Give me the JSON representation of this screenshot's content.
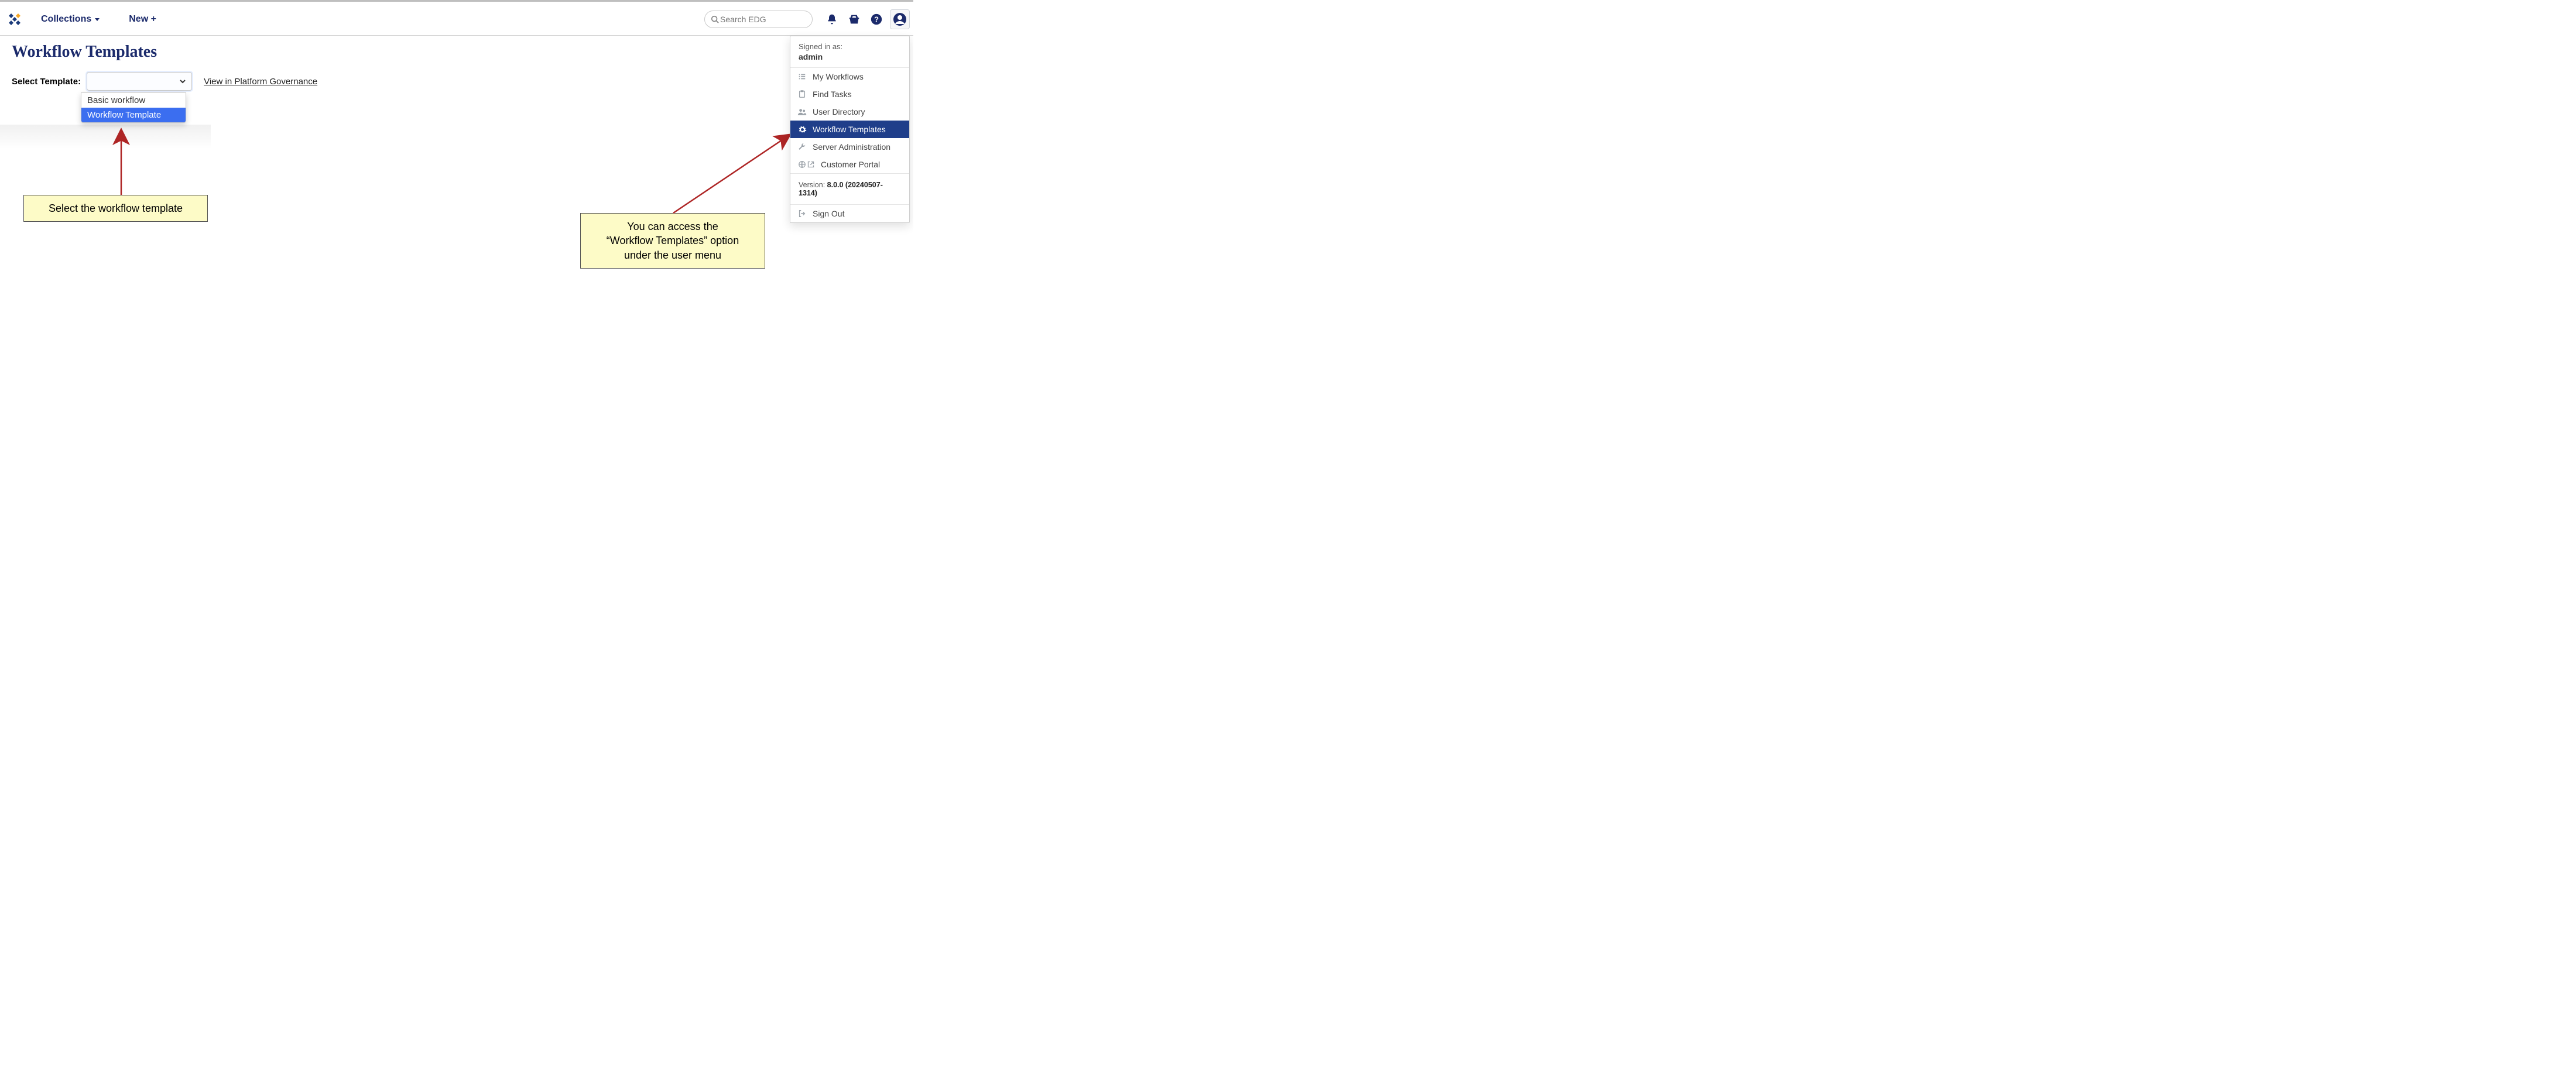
{
  "header": {
    "nav_collections": "Collections",
    "nav_new": "New +",
    "search_placeholder": "Search EDG"
  },
  "page": {
    "title": "Workflow Templates",
    "select_label": "Select Template:",
    "gov_link": "View in Platform Governance"
  },
  "dropdown": {
    "option_basic": "Basic workflow",
    "option_template": "Workflow Template"
  },
  "user_menu": {
    "signed_in_as": "Signed in as:",
    "username": "admin",
    "my_workflows": "My Workflows",
    "find_tasks": "Find Tasks",
    "user_directory": "User Directory",
    "workflow_templates": "Workflow Templates",
    "server_admin": "Server Administration",
    "customer_portal": "Customer Portal",
    "version_label": "Version: ",
    "version_value": "8.0.0 (20240507-1314)",
    "sign_out": "Sign Out"
  },
  "callouts": {
    "left": "Select the workflow template",
    "right_l1": "You can access the",
    "right_l2": "“Workflow Templates” option",
    "right_l3": "under the user menu"
  }
}
